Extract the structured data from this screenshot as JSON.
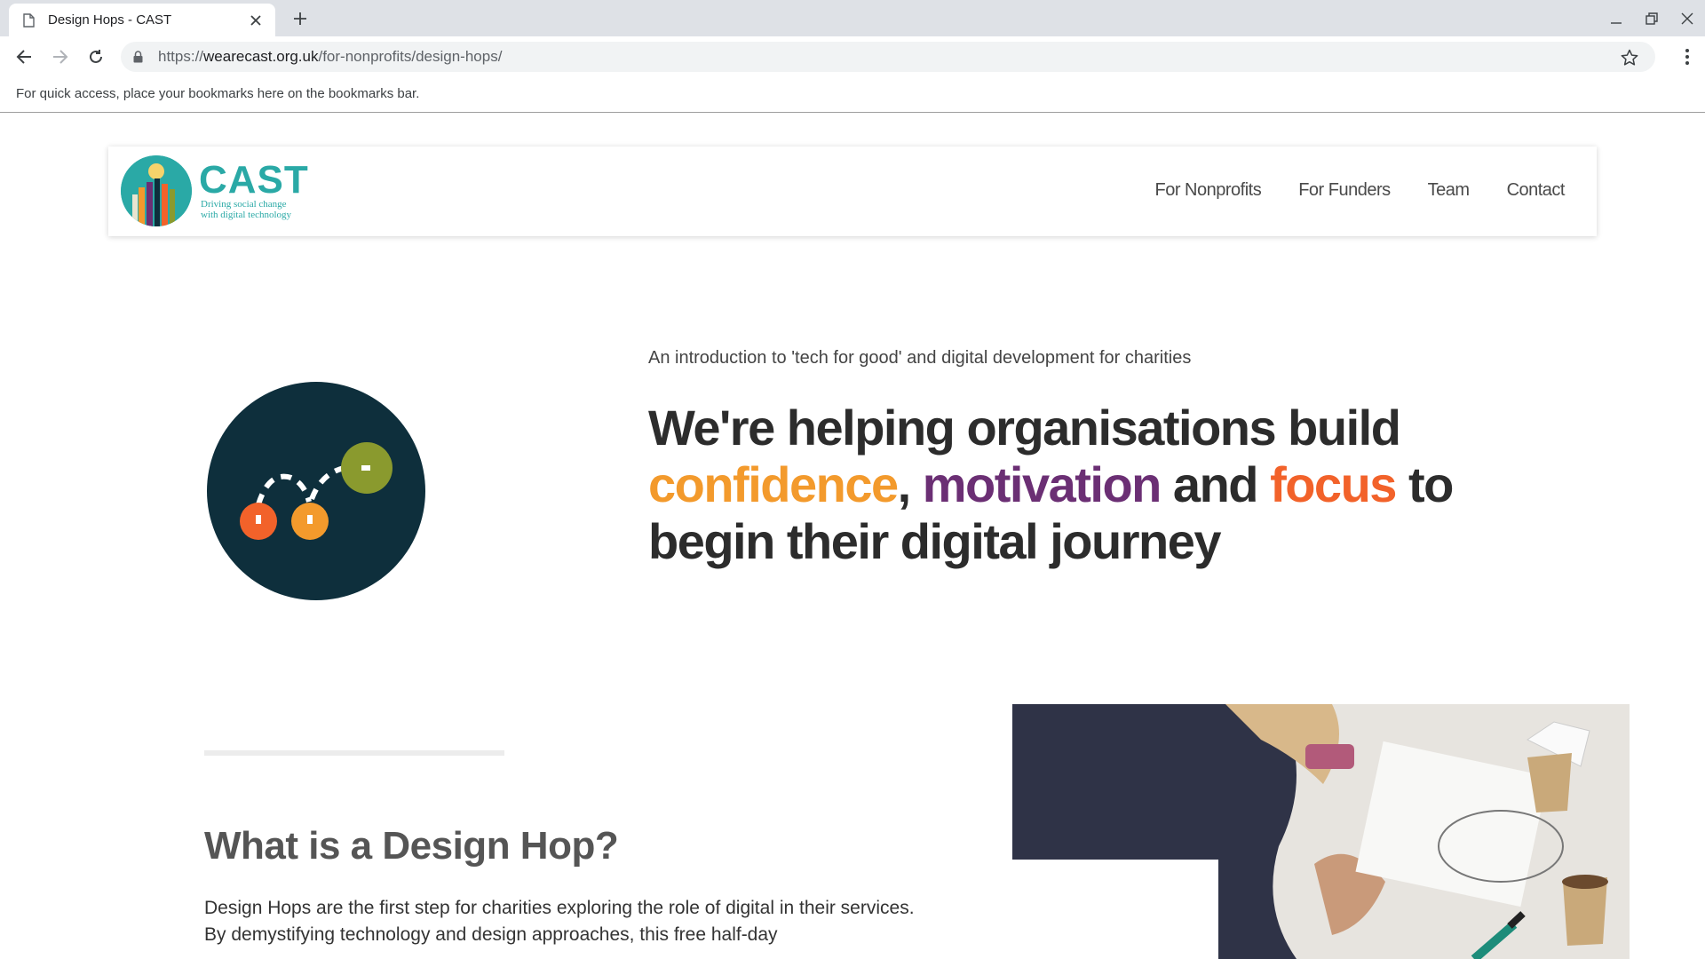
{
  "browser": {
    "tab_title": "Design Hops - CAST",
    "url_scheme": "https://",
    "url_host": "wearecast.org.uk",
    "url_path": "/for-nonprofits/design-hops/",
    "bookmarks_hint": "For quick access, place your bookmarks here on the bookmarks bar."
  },
  "site": {
    "brand": "CAST",
    "tagline_line1": "Driving social change",
    "tagline_line2": "with digital technology",
    "nav": [
      "For Nonprofits",
      "For Funders",
      "Team",
      "Contact"
    ]
  },
  "hero": {
    "kicker": "An introduction to 'tech for good' and digital development for charities",
    "heading_part1": "We're helping organisations build ",
    "word_confidence": "confidence",
    "comma": ", ",
    "word_motivation": "motivation",
    "and": " and ",
    "word_focus": "focus",
    "heading_part2": " to begin their digital journey"
  },
  "section": {
    "title": "What is a Design Hop?",
    "body": "Design Hops are the first step for charities exploring the role of digital in their services. By demystifying technology and design approaches, this free half-day"
  },
  "colors": {
    "brand_teal": "#2aa9a6",
    "confidence": "#f39a2c",
    "motivation": "#6b2f74",
    "focus": "#f2622a",
    "circle_dark": "#0e2f3c",
    "circle_green": "#8a9a2e"
  },
  "icons": {
    "tab": "document-icon",
    "close": "close-icon",
    "new_tab": "plus-icon",
    "back": "back-arrow-icon",
    "forward": "forward-arrow-icon",
    "reload": "reload-icon",
    "lock": "lock-icon",
    "bookmark": "star-icon",
    "menu": "more-vert-icon"
  }
}
